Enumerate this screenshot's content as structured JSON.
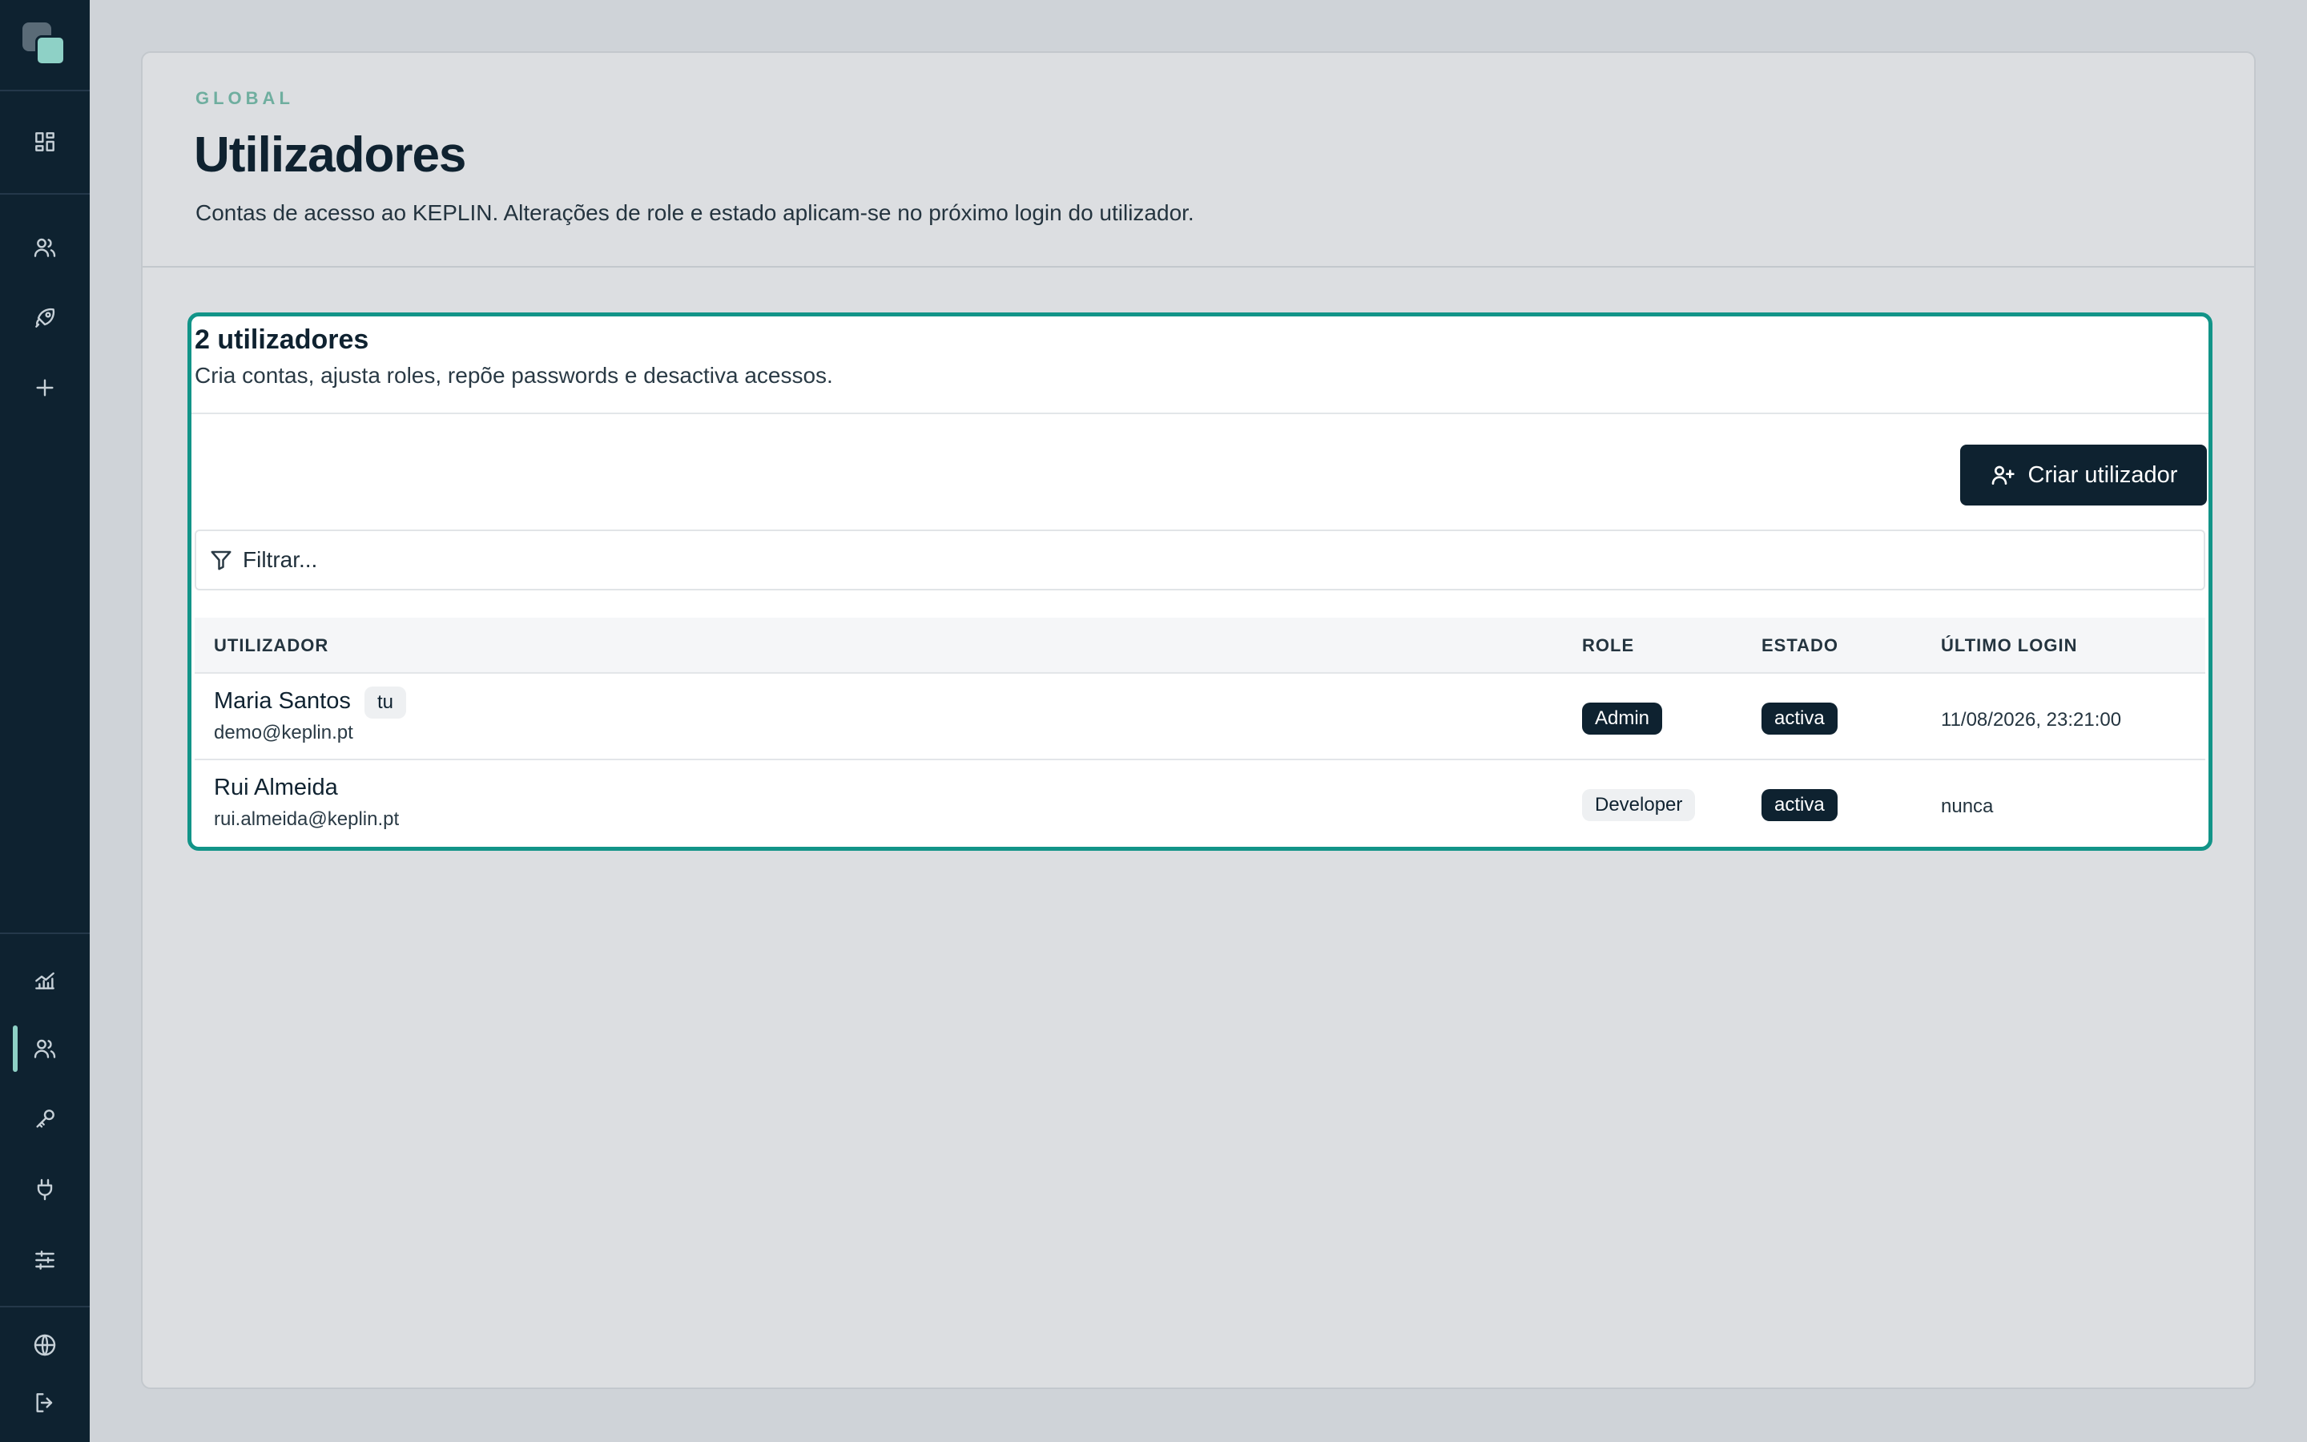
{
  "sidebar": {
    "icons": [
      "dashboard-icon",
      "users-icon",
      "rocket-icon",
      "plus-icon",
      "analytics-icon",
      "users-icon",
      "key-icon",
      "plug-icon",
      "sliders-icon",
      "globe-icon",
      "logout-icon"
    ],
    "active_item": "users",
    "accent": "#8ed1c6",
    "background": "#0e2230"
  },
  "header": {
    "section": "GLOBAL",
    "title": "Utilizadores",
    "description": "Contas de acesso ao KEPLIN. Alterações de role e estado aplicam-se no próximo login do utilizador."
  },
  "users_card": {
    "title": "2 utilizadores",
    "subtitle": "Cria contas, ajusta roles, repõe passwords e desactiva acessos.",
    "create_button": "Criar utilizador",
    "filter_placeholder": "Filtrar...",
    "border_color": "#129488",
    "columns": {
      "user": "UTILIZADOR",
      "role": "ROLE",
      "status": "ESTADO",
      "last_login": "ÚLTIMO LOGIN"
    },
    "rows": [
      {
        "name": "Maria Santos",
        "tag": "tu",
        "email": "demo@keplin.pt",
        "role": "Admin",
        "status": "activa",
        "last_login": "11/08/2026, 23:21:00"
      },
      {
        "name": "Rui Almeida",
        "email": "rui.almeida@keplin.pt",
        "role": "Developer",
        "status": "activa",
        "last_login": "nunca"
      }
    ]
  }
}
